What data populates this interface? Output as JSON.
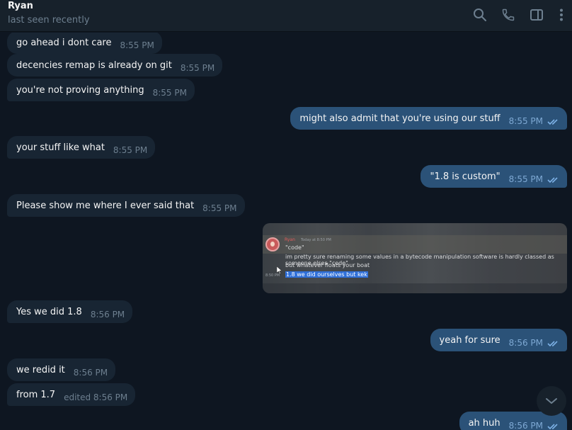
{
  "header": {
    "name": "Ryan",
    "status": "last seen recently",
    "icons": [
      "search-icon",
      "phone-icon",
      "sidebar-panel-icon",
      "more-vertical-icon"
    ]
  },
  "messages": [
    {
      "dir": "in",
      "text": "go ahead i dont care",
      "time": "8:55 PM"
    },
    {
      "dir": "in",
      "text": "decencies remap is already on git",
      "time": "8:55 PM"
    },
    {
      "dir": "in",
      "text": "you're not proving anything",
      "time": "8:55 PM"
    },
    {
      "dir": "out",
      "text": "might also admit that you're using our stuff",
      "time": "8:55 PM",
      "read": true
    },
    {
      "dir": "in",
      "text": "your stuff like what",
      "time": "8:55 PM"
    },
    {
      "dir": "out",
      "text": "\"1.8 is custom\"",
      "time": "8:55 PM",
      "read": true
    },
    {
      "dir": "in",
      "text": "Please show me where I ever said that",
      "time": "8:55 PM"
    },
    {
      "dir": "in",
      "text": "Yes we did 1.8",
      "time": "8:56 PM"
    },
    {
      "dir": "out",
      "text": "yeah for sure",
      "time": "8:56 PM",
      "read": true
    },
    {
      "dir": "in",
      "text": "we redid it",
      "time": "8:56 PM"
    },
    {
      "dir": "in",
      "text": "from 1.7",
      "time": "edited 8:56 PM"
    },
    {
      "dir": "out",
      "text": "ah huh",
      "time": "8:56 PM",
      "read": true
    }
  ],
  "image_message": {
    "author": "Ryan",
    "date": "Today at 8:50 PM",
    "lines": [
      "\"code\"",
      "im pretty sure renaming some values in a bytecode manipulation software is hardly classed as someone elses \"code\"",
      "but whatever floats your boat",
      "1.8 we did ourselves but kek"
    ],
    "stamp": "8:50 PM"
  },
  "colors": {
    "background": "#0e1621",
    "header": "#17212b",
    "incoming": "#182533",
    "outgoing": "#2b5278",
    "read_check": "#7db1e6"
  }
}
